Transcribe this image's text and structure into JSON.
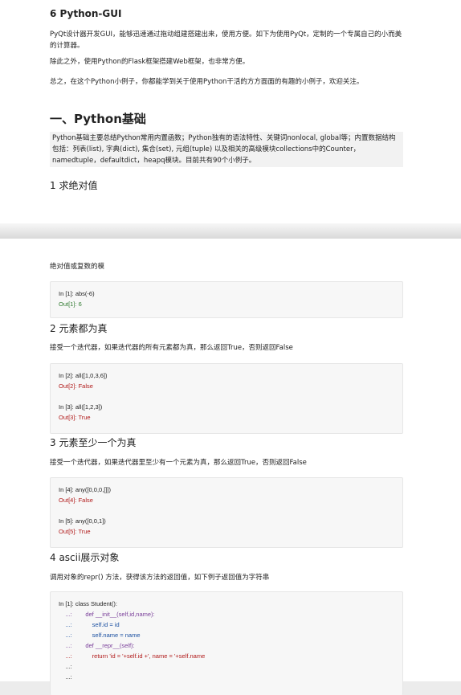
{
  "page1": {
    "title": "6 Python-GUI",
    "para1": "PyQt设计器开发GUI，能够迅速通过拖动组建搭建出来，使用方便。如下为使用PyQt，定制的一个专属自己的小而美的计算器。",
    "para2": "除此之外，使用Python的Flask框架搭建Web框架，也非常方便。",
    "para3": "总之，在这个Python小例子，你都能学到关于使用Python干活的方方面面的有趣的小例子，欢迎关注。",
    "section": "一、Python基础",
    "intro": "Python基础主要总结Python常用内置函数；Python独有的语法特性、关键词nonlocal, global等；内置数据结构包括：列表(list), 字典(dict), 集合(set), 元组(tuple) 以及相关的高级模块collections中的Counter，namedtuple，defaultdict，heapq模块。目前共有90个小例子。",
    "h1": "1 求绝对值"
  },
  "page2": {
    "abs_desc": "绝对值或复数的模",
    "abs_code": [
      "In [1]: abs(-6)",
      "Out[1]: 6"
    ],
    "h2": "2 元素都为真",
    "all_desc": "接受一个迭代器，如果迭代器的所有元素都为真，那么返回True，否则返回False",
    "all_code": [
      "In [2]: all([1,0,3,6])",
      "Out[2]: False",
      "",
      "In [3]: all([1,2,3])",
      "Out[3]: True"
    ],
    "h3": "3 元素至少一个为真",
    "any_desc": "接受一个迭代器，如果迭代器里至少有一个元素为真，那么返回True，否则返回False",
    "any_code": [
      "In [4]: any([0,0,0,[]])",
      "Out[4]: False",
      "",
      "In [5]: any([0,0,1])",
      "Out[5]: True"
    ],
    "h4": "4 ascii展示对象",
    "repr_desc": "调用对象的repr() 方法，获得该方法的返回值，如下例子返回值为字符串",
    "class_code": [
      "In [1]: class Student():",
      "    ...:        def __init__(self,id,name):",
      "    ...:            self.id = id",
      "    ...:            self.name = name",
      "    ...:        def __repr__(self):",
      "    ...:            return 'id = '+self.id +', name = '+self.name",
      "    ...:",
      "    ...:"
    ]
  }
}
